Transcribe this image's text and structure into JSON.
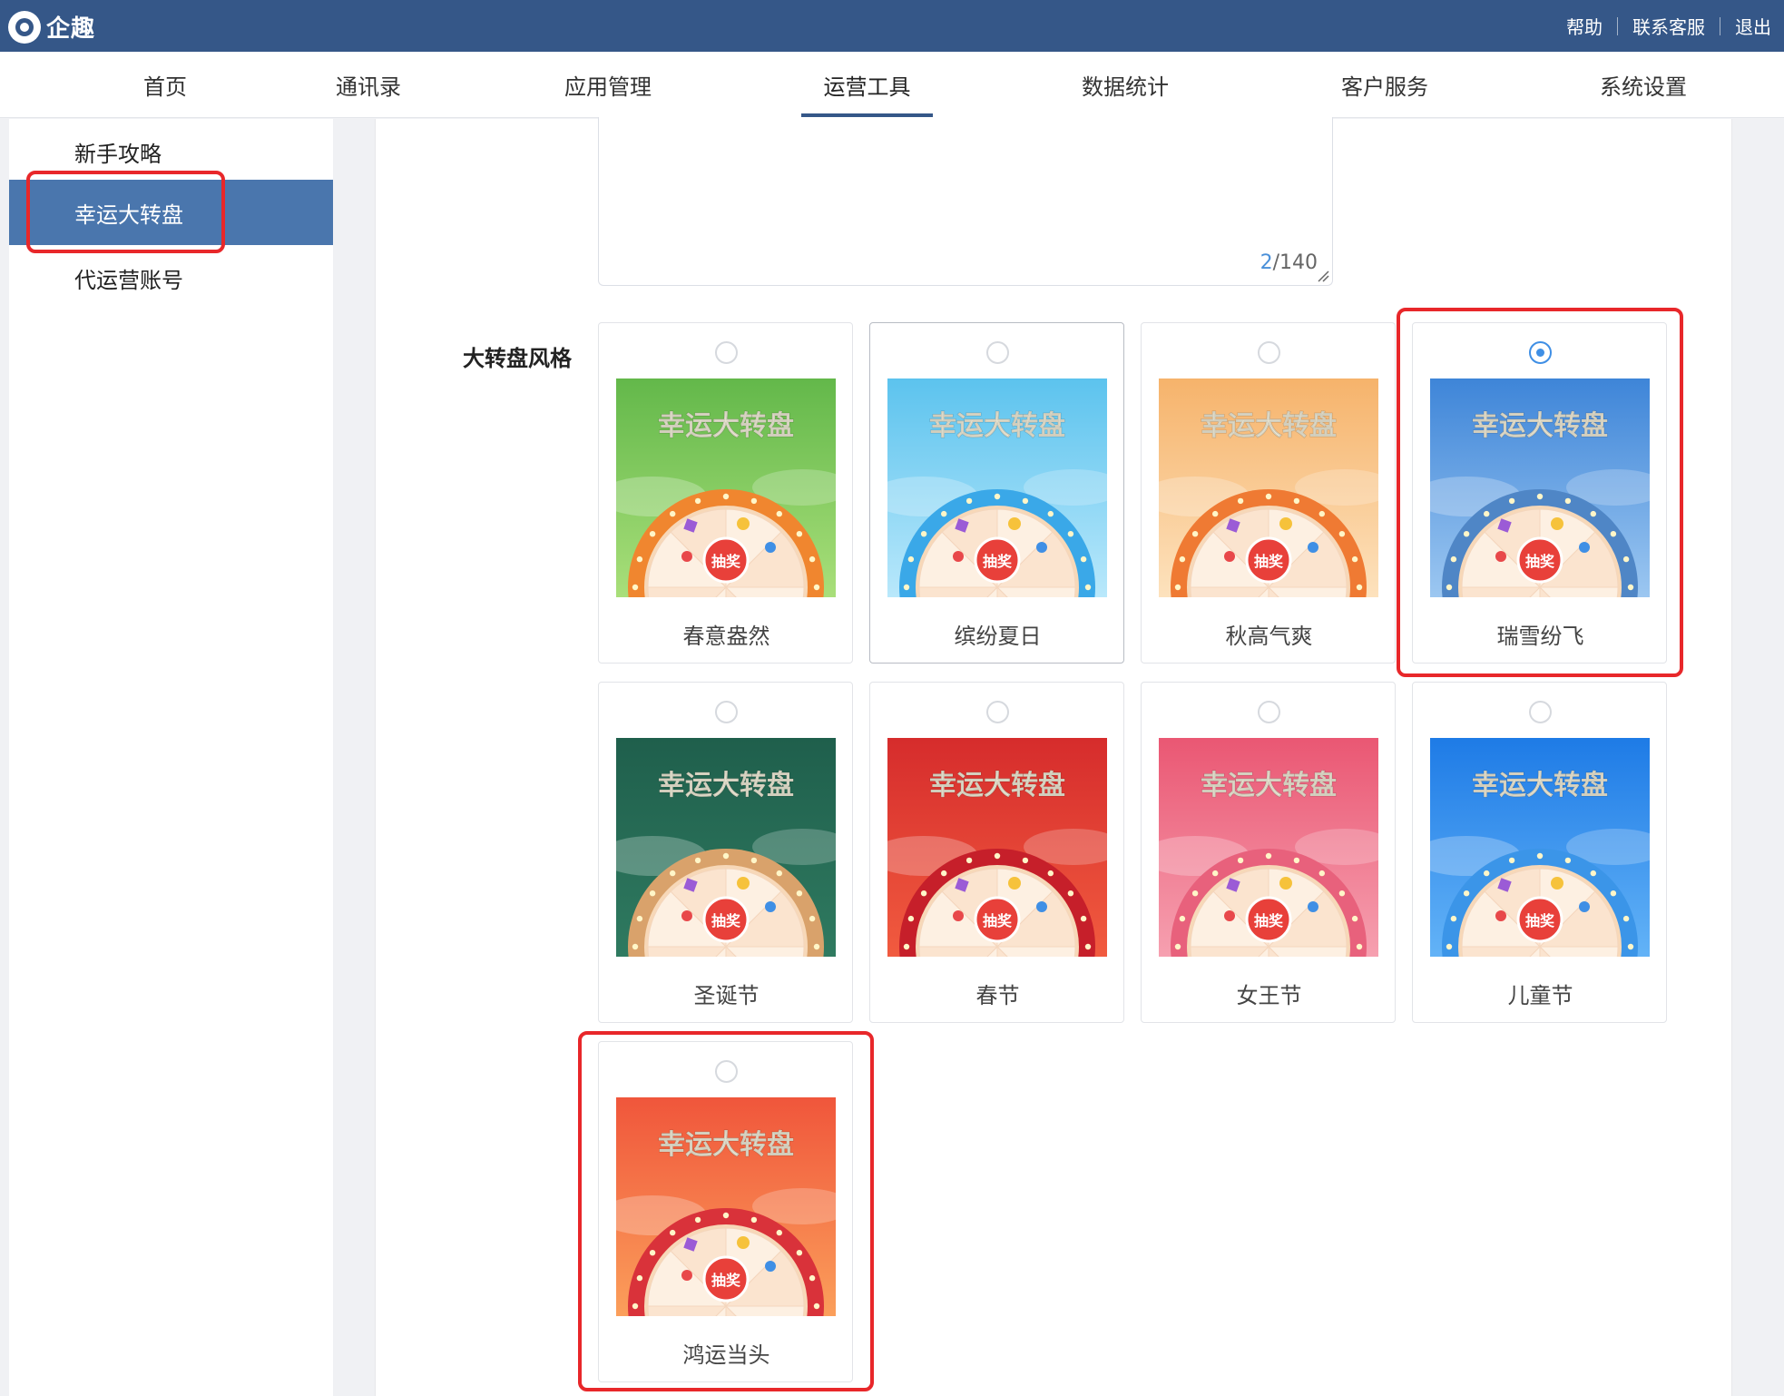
{
  "app": {
    "logo_text": "企趣"
  },
  "top_links": [
    "帮助",
    "联系客服",
    "退出"
  ],
  "nav": {
    "items": [
      "首页",
      "通讯录",
      "应用管理",
      "运营工具",
      "数据统计",
      "客户服务",
      "系统设置"
    ],
    "active_index": 3
  },
  "sidebar": {
    "items": [
      "新手攻略",
      "幸运大转盘",
      "代运营账号"
    ],
    "active_index": 1
  },
  "form": {
    "textarea": {
      "count_current": "2",
      "count_max": "/140"
    },
    "style_label": "大转盘风格",
    "selected_index": 3,
    "thumb_title": "幸运大转盘",
    "thumb_center": "抽奖",
    "styles": [
      {
        "name": "春意盎然",
        "bg": "#63b84a",
        "bg2": "#a9df7a",
        "rim": "#f0862f"
      },
      {
        "name": "缤纷夏日",
        "bg": "#5cc3ee",
        "bg2": "#b9e8fb",
        "rim": "#3aa8e8"
      },
      {
        "name": "秋高气爽",
        "bg": "#f6b36b",
        "bg2": "#fde2bd",
        "rim": "#ef7a33"
      },
      {
        "name": "瑞雪纷飞",
        "bg": "#3e85d8",
        "bg2": "#9cc7f1",
        "rim": "#4f86c6"
      },
      {
        "name": "圣诞节",
        "bg": "#1f5f4c",
        "bg2": "#2f7a60",
        "rim": "#d9a26b"
      },
      {
        "name": "春节",
        "bg": "#d62c2c",
        "bg2": "#f15b3f",
        "rim": "#c61f2a"
      },
      {
        "name": "女王节",
        "bg": "#ea5773",
        "bg2": "#f6a0b0",
        "rim": "#e8617c"
      },
      {
        "name": "儿童节",
        "bg": "#1e7be6",
        "bg2": "#63b3f7",
        "rim": "#3b95e8"
      },
      {
        "name": "鸿运当头",
        "bg": "#f0563b",
        "bg2": "#fb9f5b",
        "rim": "#d9323a"
      }
    ]
  }
}
